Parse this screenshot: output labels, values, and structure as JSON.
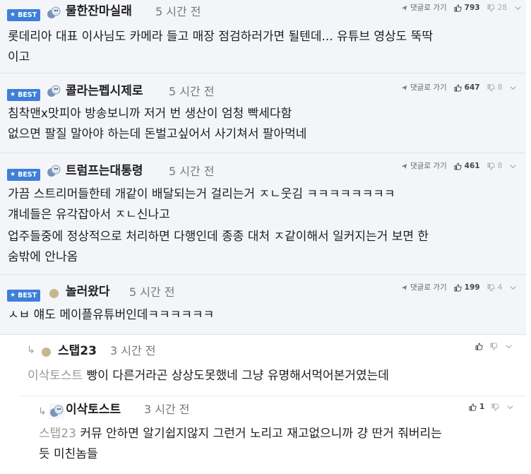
{
  "ui": {
    "best_label": "BEST",
    "reply_link": "댓글로 가기"
  },
  "comments": [
    {
      "nick": "물한잔마실래",
      "time": "5 시간 전",
      "up": "793",
      "down": "28",
      "lines": [
        "롯데리아 대표 이사님도 카메라 들고 매장 점검하러가면 될텐데... 유튜브 영상도 뚝딱",
        "이고"
      ]
    },
    {
      "nick": "콜라는펩시제로",
      "time": "5 시간 전",
      "up": "647",
      "down": "8",
      "lines": [
        "침착맨x맛피아 방송보니까 저거 번 생산이 엄청 빡세다함",
        "없으면 팔질 말아야 하는데 돈벌고싶어서 사기쳐서 팔아먹네"
      ]
    },
    {
      "nick": "트럼프는대통령",
      "time": "5 시간 전",
      "up": "461",
      "down": "8",
      "lines": [
        "가끔 스트리머들한테 개같이 배달되는거 걸리는거 ㅈㄴ웃김 ㅋㅋㅋㅋㅋㅋㅋㅋ",
        "걔네들은 유각잡아서 ㅈㄴ신나고",
        "업주들중에 정상적으로 처리하면 다행인데 종종 대처 ㅈ같이해서 일커지는거 보면 한",
        "숨밖에 안나옴"
      ]
    },
    {
      "nick": "놀러왔다",
      "time": "5 시간 전",
      "up": "199",
      "down": "4",
      "lines": [
        "ㅅㅂ 얘도 메이플유튜버인데ㅋㅋㅋㅋㅋㅋ"
      ]
    }
  ],
  "replies": [
    {
      "nick": "스탭23",
      "time": "3 시간 전",
      "up": "",
      "down": "",
      "quote": "이삭토스트",
      "lines": [
        "빵이 다른거라곤 상상도못했네 그냥 유명해서먹어본거였는데"
      ]
    },
    {
      "nick": "이삭토스트",
      "time": "3 시간 전",
      "up": "1",
      "down": "",
      "quote": "스탭23",
      "lines": [
        "커뮤 안하면 알기쉽지않지 그런거 노리고 재고없으니까 걍 딴거 줘버리는",
        "듯 미친놈들"
      ]
    }
  ]
}
